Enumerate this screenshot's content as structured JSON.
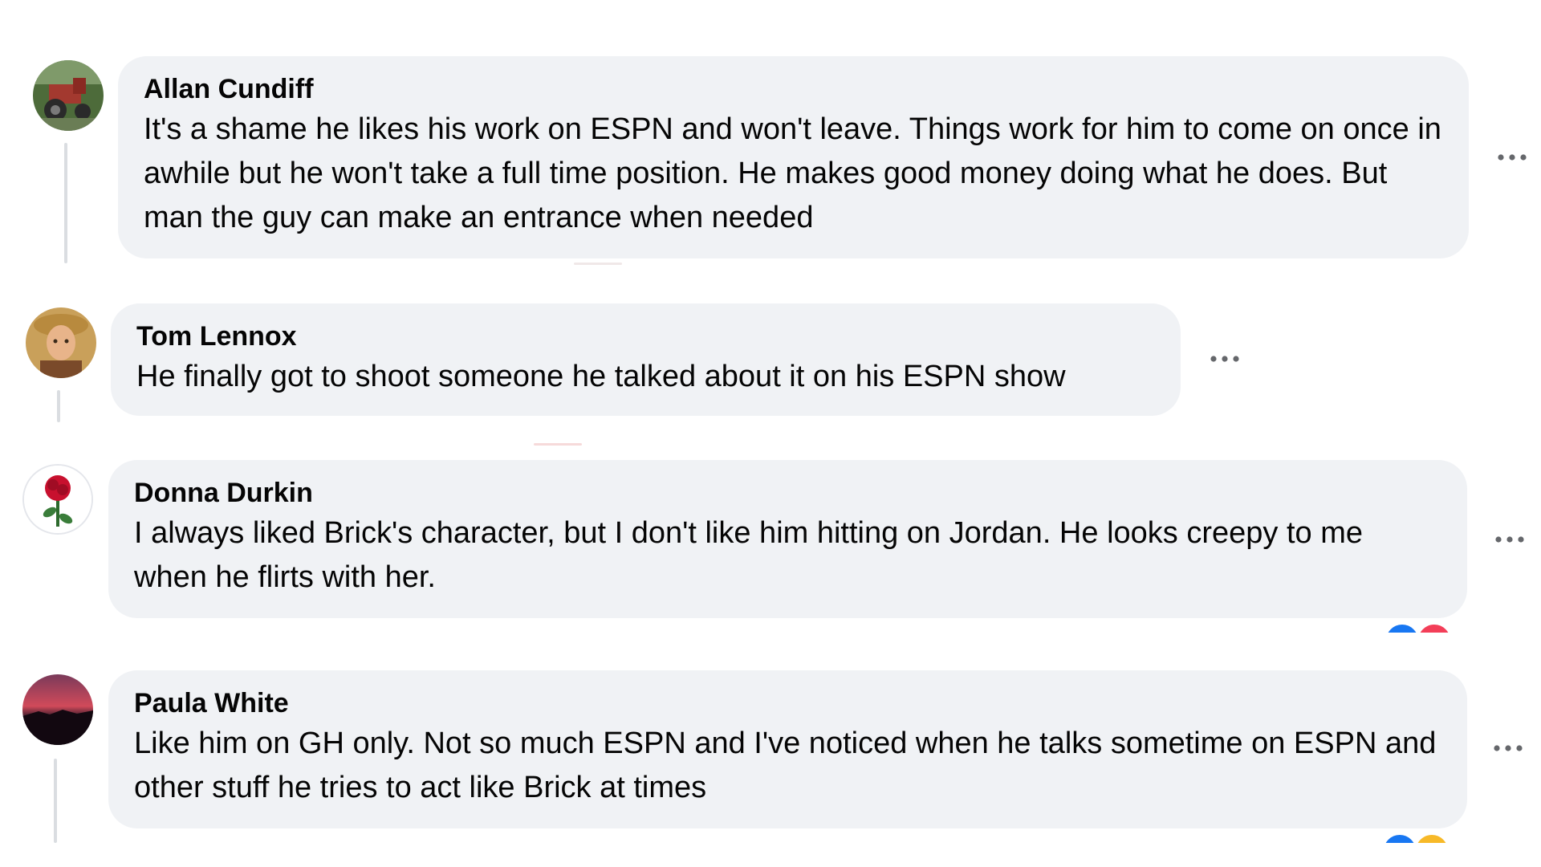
{
  "comments": [
    {
      "author": "Allan Cundiff",
      "text": "It's a shame he likes his work on ESPN and won't leave. Things work for him to come on once in awhile but he won't take a full time position. He makes good money doing what he does. But man the guy can make an entrance when needed",
      "avatar": "avatar-tractor",
      "more_icon": "more-options-icon"
    },
    {
      "author": "Tom Lennox",
      "text": "He finally got to shoot someone he talked about it on his ESPN show",
      "avatar": "avatar-portrait",
      "more_icon": "more-options-icon"
    },
    {
      "author": "Donna Durkin",
      "text": "I always liked Brick's character, but I don't like him hitting on Jordan. He looks creepy to me when he flirts with her.",
      "avatar": "avatar-rose",
      "more_icon": "more-options-icon",
      "reactions": [
        "like-reaction-icon",
        "love-reaction-icon"
      ]
    },
    {
      "author": "Paula White",
      "text": "Like him on GH only. Not so much ESPN and I've noticed when he talks sometime on ESPN and other stuff he tries to act like Brick at times",
      "avatar": "avatar-sunset",
      "more_icon": "more-options-icon",
      "reactions": [
        "like-reaction-icon",
        "haha-reaction-icon"
      ]
    }
  ],
  "colors": {
    "bubble": "#f0f2f5",
    "text": "#050505",
    "thread_line": "#dadde1",
    "more_dots": "#65676b",
    "like": "#1877f2",
    "love": "#f33e58",
    "haha": "#f7b928"
  }
}
